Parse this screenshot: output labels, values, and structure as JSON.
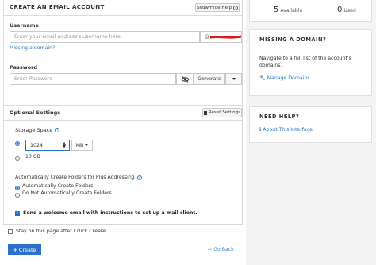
{
  "create_account": {
    "title": "CREATE AN EMAIL ACCOUNT",
    "show_hide_help": "Show/Hide Help",
    "username": {
      "label": "Username",
      "placeholder": "Enter your email address's username here.",
      "domain_value": "@"
    },
    "missing_domain_link": "Missing a domain?",
    "password": {
      "label": "Password",
      "placeholder": "Enter Password",
      "generate_label": "Generate"
    },
    "optional_settings": {
      "title": "Optional Settings",
      "reset_label": "Reset Settings",
      "storage_label": "Storage Space",
      "storage_value": "1024",
      "storage_unit": "MB",
      "storage_alt_option": "10 GB",
      "folders_label": "Automatically Create Folders for Plus Addressing",
      "folders_options": [
        "Automatically Create Folders",
        "Do Not Automatically Create Folders"
      ],
      "welcome_email_label": "Send a welcome email with instructions to set up a mail client."
    },
    "stay_on_page": {
      "prefix": "Stay on this page after I click ",
      "emphasis": "Create",
      "suffix": "."
    },
    "create_button": "Create",
    "go_back": "Go Back"
  },
  "sidebar": {
    "stats": {
      "available_count": "5",
      "available_label": "Available",
      "used_count": "0",
      "used_label": "Used"
    },
    "missing_domain": {
      "title": "MISSING A DOMAIN?",
      "text": "Navigate to a full list of the account's domains.",
      "link": "Manage Domains"
    },
    "need_help": {
      "title": "NEED HELP?",
      "link": "About This Interface"
    }
  },
  "colors": {
    "primary": "#2a6fc9",
    "link": "#2f7bbf",
    "redaction": "#e01818"
  }
}
